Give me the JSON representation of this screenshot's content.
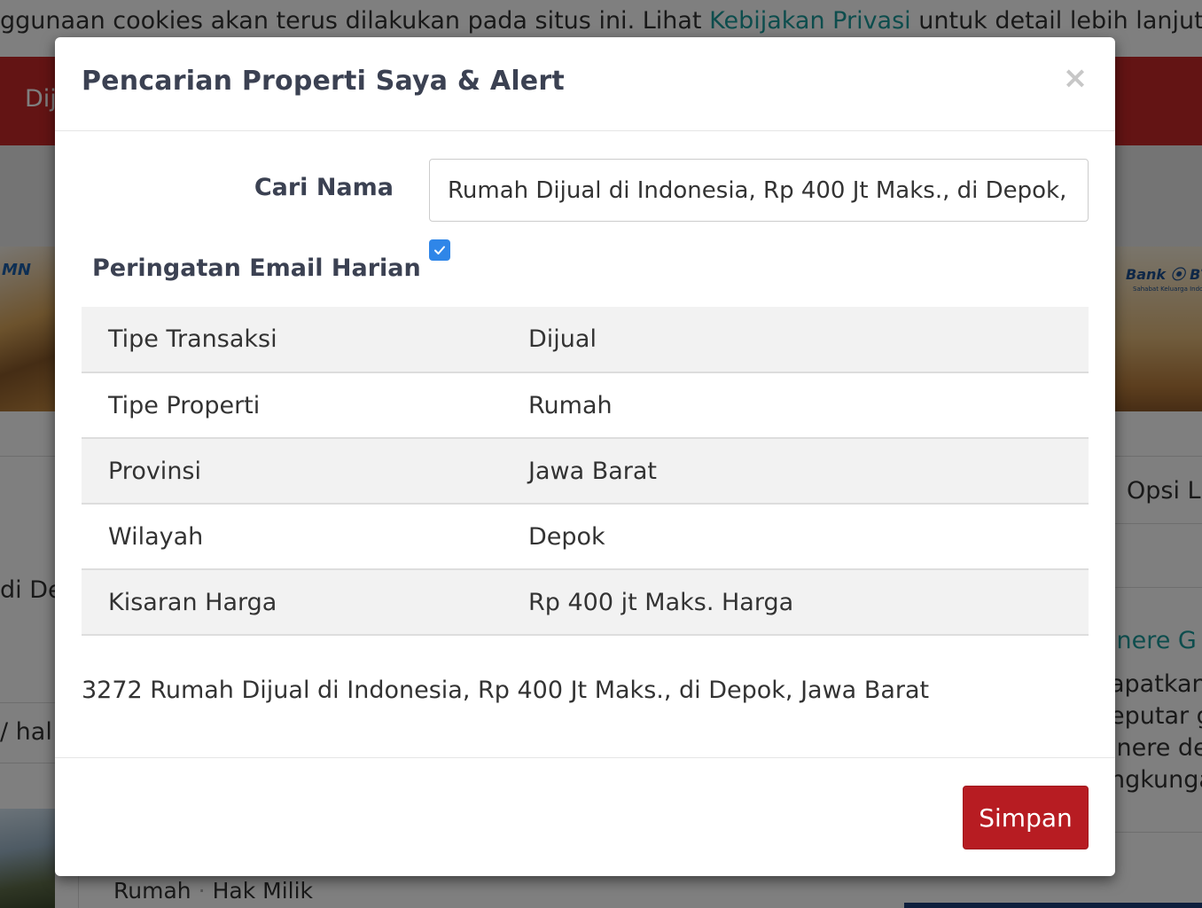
{
  "background": {
    "cookie_notice": {
      "text_before_link": "ggunaan cookies akan terus dilakukan pada situs ini. Lihat ",
      "link_text": "Kebijakan Privasi",
      "text_after_link": " untuk detail lebih lanjut."
    },
    "nav_partial": "Dij",
    "ad_left_brand": "MN",
    "ad_right_brand": "Bank ⦿ BTN",
    "ad_right_sub": "Sahabat Keluarga Indonesia",
    "options_partial": "Opsi La",
    "heading_partial": "di De",
    "per_page_partial": "/ hal",
    "sidebar_link_partial": "inere G",
    "sidebar_text_lines": [
      "apatkan",
      "eputar g",
      "inere de",
      "ngkunga"
    ],
    "listing": {
      "type": "Rumah",
      "ownership": "Hak Milik"
    }
  },
  "modal": {
    "title": "Pencarian Properti Saya & Alert",
    "close_symbol": "×",
    "search_name": {
      "label": "Cari Nama",
      "value": "Rumah Dijual di Indonesia, Rp 400 Jt Maks., di Depok, Jawa Barat"
    },
    "daily_email_alert": {
      "label": "Peringatan Email Harian",
      "checked": true
    },
    "criteria": [
      {
        "label": "Tipe Transaksi",
        "value": "Dijual"
      },
      {
        "label": "Tipe Properti",
        "value": "Rumah"
      },
      {
        "label": "Provinsi",
        "value": "Jawa Barat"
      },
      {
        "label": "Wilayah",
        "value": "Depok"
      },
      {
        "label": "Kisaran Harga",
        "value": "Rp 400 jt Maks. Harga"
      }
    ],
    "summary": "3272 Rumah Dijual di Indonesia, Rp 400 Jt Maks., di Depok, Jawa Barat",
    "save_label": "Simpan"
  },
  "colors": {
    "accent_red": "#b71c22",
    "nav_red": "#c62828",
    "link_teal": "#1a9a9a",
    "checkbox_blue": "#2f86e8"
  }
}
